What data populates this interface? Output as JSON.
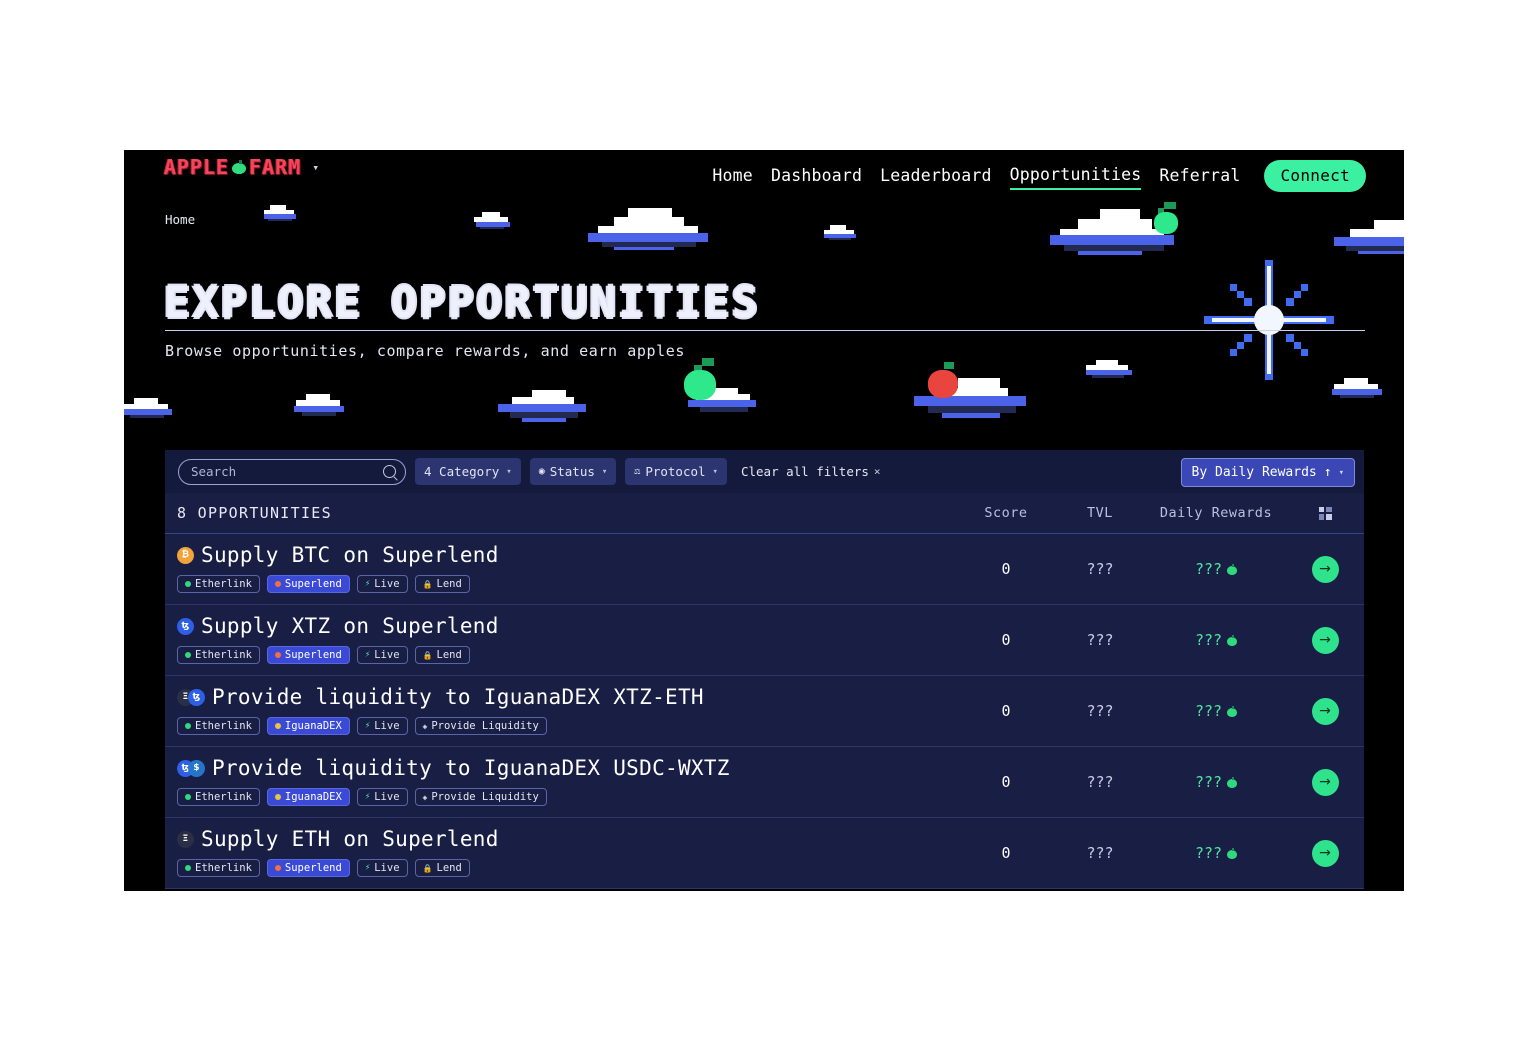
{
  "brand": {
    "name_left": "APPLE",
    "name_right": "FARM",
    "chevron": "chevron-down-icon"
  },
  "nav": {
    "items": [
      {
        "label": "Home",
        "active": false
      },
      {
        "label": "Dashboard",
        "active": false
      },
      {
        "label": "Leaderboard",
        "active": false
      },
      {
        "label": "Opportunities",
        "active": true
      },
      {
        "label": "Referral",
        "active": false
      }
    ],
    "connect_label": "Connect",
    "accent": "#3bf0a0"
  },
  "hero": {
    "breadcrumb": "Home",
    "title": "EXPLORE OPPORTUNITIES",
    "subtitle": "Browse opportunities, compare rewards, and earn apples"
  },
  "filters": {
    "search_placeholder": "Search",
    "search_value": "",
    "category_label": "4 Category",
    "status_label": "Status",
    "protocol_label": "Protocol",
    "clear_label": "Clear all filters",
    "sort_label": "By Daily Rewards",
    "sort_direction": "↑"
  },
  "table": {
    "count_label": "8 OPPORTUNITIES",
    "columns": {
      "score": "Score",
      "tvl": "TVL",
      "rewards": "Daily Rewards",
      "view_toggle": "grid-view-icon"
    },
    "rows": [
      {
        "title": "Supply BTC on Superlend",
        "tokens": [
          {
            "symbol": "₿",
            "color": "#f2a33c"
          }
        ],
        "badges": [
          {
            "label": "Etherlink",
            "type": "chain",
            "dot": "#2fd97d"
          },
          {
            "label": "Superlend",
            "type": "protocol",
            "dot": "#f2703c"
          },
          {
            "label": "Live",
            "type": "status"
          },
          {
            "label": "Lend",
            "type": "category",
            "icon": "🔒"
          }
        ],
        "score": "0",
        "tvl": "???",
        "rewards": "???"
      },
      {
        "title": "Supply XTZ on Superlend",
        "tokens": [
          {
            "symbol": "ꜩ",
            "color": "#2d5fe8"
          }
        ],
        "badges": [
          {
            "label": "Etherlink",
            "type": "chain",
            "dot": "#2fd97d"
          },
          {
            "label": "Superlend",
            "type": "protocol",
            "dot": "#f2703c"
          },
          {
            "label": "Live",
            "type": "status"
          },
          {
            "label": "Lend",
            "type": "category",
            "icon": "🔒"
          }
        ],
        "score": "0",
        "tvl": "???",
        "rewards": "???"
      },
      {
        "title": "Provide liquidity to IguanaDEX XTZ-ETH",
        "tokens": [
          {
            "symbol": "Ξ",
            "color": "#2b2f45"
          },
          {
            "symbol": "ꜩ",
            "color": "#2d5fe8"
          }
        ],
        "badges": [
          {
            "label": "Etherlink",
            "type": "chain",
            "dot": "#2fd97d"
          },
          {
            "label": "IguanaDEX",
            "type": "protocol",
            "dot": "#e5c63c"
          },
          {
            "label": "Live",
            "type": "status"
          },
          {
            "label": "Provide Liquidity",
            "type": "category",
            "icon": "◈"
          }
        ],
        "score": "0",
        "tvl": "???",
        "rewards": "???"
      },
      {
        "title": "Provide liquidity to IguanaDEX USDC-WXTZ",
        "tokens": [
          {
            "symbol": "ꜩ",
            "color": "#2d5fe8"
          },
          {
            "symbol": "$",
            "color": "#2775ca"
          }
        ],
        "badges": [
          {
            "label": "Etherlink",
            "type": "chain",
            "dot": "#2fd97d"
          },
          {
            "label": "IguanaDEX",
            "type": "protocol",
            "dot": "#e5c63c"
          },
          {
            "label": "Live",
            "type": "status"
          },
          {
            "label": "Provide Liquidity",
            "type": "category",
            "icon": "◈"
          }
        ],
        "score": "0",
        "tvl": "???",
        "rewards": "???"
      },
      {
        "title": "Supply ETH on Superlend",
        "tokens": [
          {
            "symbol": "Ξ",
            "color": "#2b2f45"
          }
        ],
        "badges": [
          {
            "label": "Etherlink",
            "type": "chain",
            "dot": "#2fd97d"
          },
          {
            "label": "Superlend",
            "type": "protocol",
            "dot": "#f2703c"
          },
          {
            "label": "Live",
            "type": "status"
          },
          {
            "label": "Lend",
            "type": "category",
            "icon": "🔒"
          }
        ],
        "score": "0",
        "tvl": "???",
        "rewards": "???"
      }
    ],
    "row_action_icon": "→"
  },
  "theme": {
    "page_bg": "#000000",
    "panel_bg": "#191e44",
    "filter_bg": "#141a3c",
    "accent_green": "#3bf0a0",
    "reward_green": "#4fe3a2",
    "chip_blue": "#3b4ad6"
  }
}
